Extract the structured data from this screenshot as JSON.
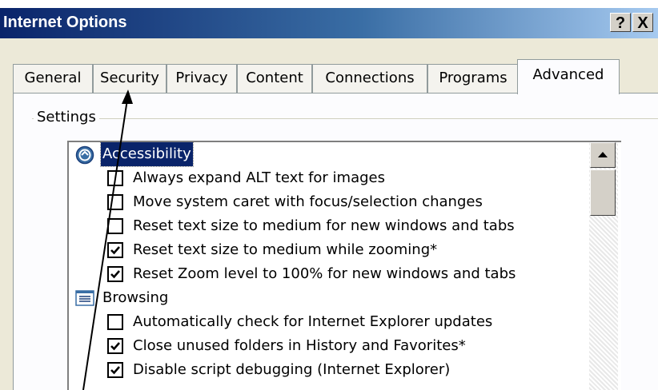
{
  "window": {
    "title": "Internet Options",
    "help_label": "?",
    "close_label": "X"
  },
  "tabs": [
    {
      "label": "General"
    },
    {
      "label": "Security"
    },
    {
      "label": "Privacy"
    },
    {
      "label": "Content"
    },
    {
      "label": "Connections"
    },
    {
      "label": "Programs"
    },
    {
      "label": "Advanced",
      "active": true
    }
  ],
  "settings": {
    "group_label": "Settings",
    "categories": [
      {
        "label": "Accessibility",
        "icon": "accessibility-icon",
        "selected": true,
        "items": [
          {
            "label": "Always expand ALT text for images",
            "checked": false
          },
          {
            "label": "Move system caret with focus/selection changes",
            "checked": false
          },
          {
            "label": "Reset text size to medium for new windows and tabs",
            "checked": false
          },
          {
            "label": "Reset text size to medium while zooming*",
            "checked": true
          },
          {
            "label": "Reset Zoom level to 100% for new windows and tabs",
            "checked": true
          }
        ]
      },
      {
        "label": "Browsing",
        "icon": "list-document-icon",
        "selected": false,
        "items": [
          {
            "label": "Automatically check for Internet Explorer updates",
            "checked": false
          },
          {
            "label": "Close unused folders in History and Favorites*",
            "checked": true
          },
          {
            "label": "Disable script debugging (Internet Explorer)",
            "checked": true
          }
        ]
      }
    ]
  },
  "colors": {
    "title_bar": "#0a246a",
    "selection": "#0a246a",
    "dialog_bg": "#ece9d8",
    "tab_border": "#919b9c"
  }
}
